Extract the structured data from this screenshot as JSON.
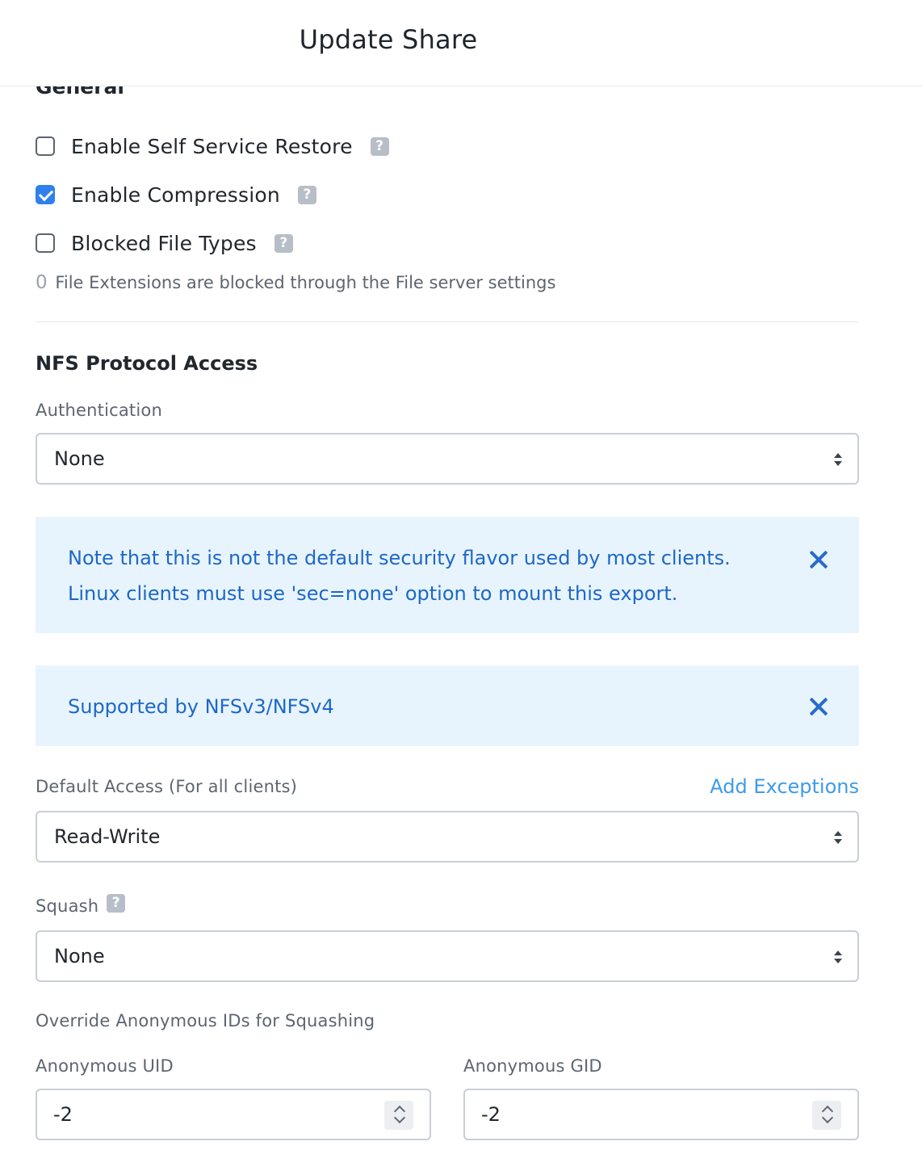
{
  "header": {
    "title": "Update Share"
  },
  "general": {
    "heading": "General",
    "self_service_restore": {
      "label": "Enable Self Service Restore",
      "checked": false
    },
    "compression": {
      "label": "Enable Compression",
      "checked": true
    },
    "blocked_file_types": {
      "label": "Blocked File Types",
      "checked": false
    },
    "blocked_count": "0",
    "blocked_note": "File Extensions are blocked through the File server settings",
    "help_glyph": "?"
  },
  "nfs": {
    "heading": "NFS Protocol Access",
    "authentication": {
      "label": "Authentication",
      "value": "None"
    },
    "alert_security": {
      "line1": "Note that this is not the default security flavor used by most clients.",
      "line2": "Linux clients must use 'sec=none' option to mount this export."
    },
    "alert_version": {
      "text": "Supported by NFSv3/NFSv4"
    },
    "default_access": {
      "label": "Default Access (For all clients)",
      "value": "Read-Write",
      "link": "Add Exceptions"
    },
    "squash": {
      "label": "Squash",
      "value": "None"
    },
    "override_label": "Override Anonymous IDs for Squashing",
    "anon_uid": {
      "label": "Anonymous UID",
      "value": "-2"
    },
    "anon_gid": {
      "label": "Anonymous GID",
      "value": "-2"
    }
  },
  "colors": {
    "accent": "#2f80ed",
    "alert_bg": "#e8f4fd",
    "alert_text": "#1d68c8",
    "link": "#3d9be9"
  }
}
